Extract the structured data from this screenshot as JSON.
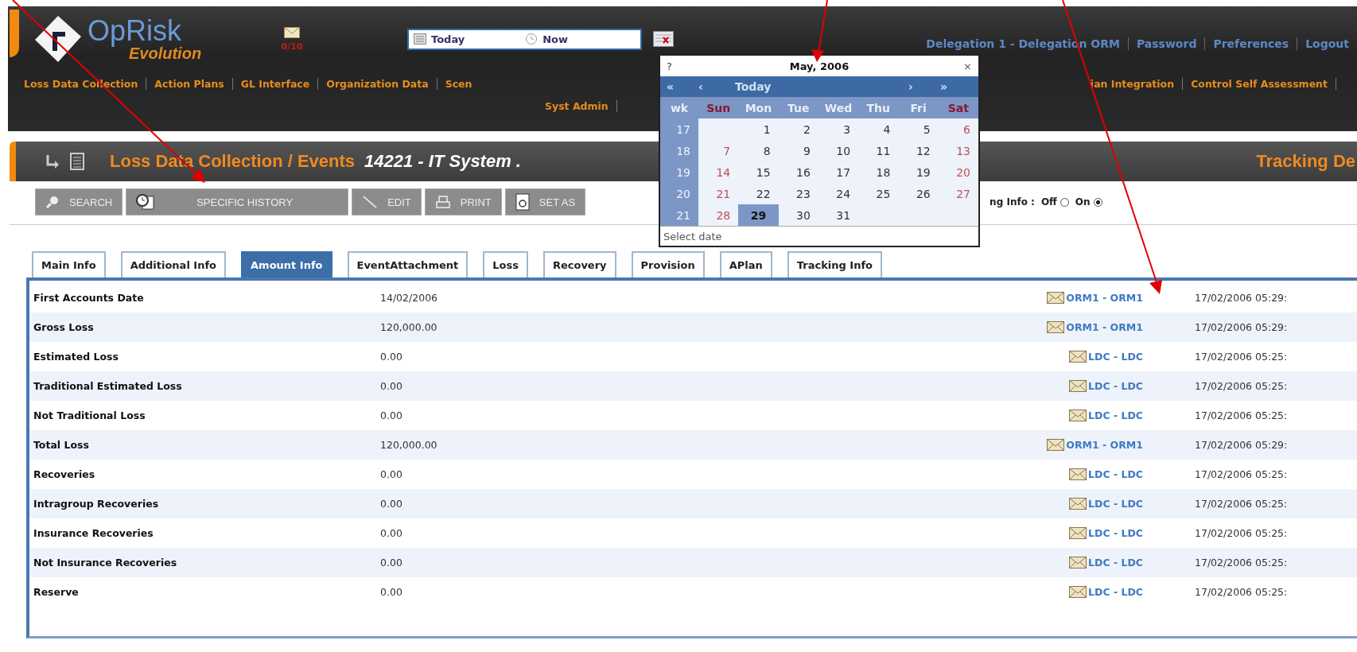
{
  "header": {
    "logo": {
      "name": "OpRisk",
      "tagline": "Evolution"
    },
    "messages": {
      "count": "0/10"
    },
    "date_field": {
      "today": "Today",
      "now": "Now"
    },
    "user_links": [
      "Delegation 1 - Delegation ORM",
      "Password",
      "Preferences",
      "Logout"
    ],
    "menu_left": [
      "Loss Data Collection",
      "Action Plans",
      "GL Interface",
      "Organization Data",
      "Scen"
    ],
    "menu_right": [
      "ian Integration",
      "Control Self Assessment"
    ],
    "menu_second": [
      "Syst Admin"
    ]
  },
  "calendar": {
    "help": "?",
    "title": "May, 2006",
    "close": "×",
    "nav": [
      "«",
      "‹",
      "Today",
      "›",
      "»"
    ],
    "week_label": "wk",
    "weekdays": [
      {
        "label": "Sun",
        "weekend": true
      },
      {
        "label": "Mon",
        "weekend": false
      },
      {
        "label": "Tue",
        "weekend": false
      },
      {
        "label": "Wed",
        "weekend": false
      },
      {
        "label": "Thu",
        "weekend": false
      },
      {
        "label": "Fri",
        "weekend": false
      },
      {
        "label": "Sat",
        "weekend": true
      }
    ],
    "weeks": [
      {
        "number": "17",
        "days": [
          {
            "d": "1",
            "selected": false
          },
          {
            "d": "2",
            "selected": false
          },
          {
            "d": "3",
            "selected": false
          },
          {
            "d": "4",
            "selected": false
          },
          {
            "d": "5",
            "selected": false
          },
          {
            "d": "6",
            "selected": false
          }
        ]
      },
      {
        "number": "18",
        "days": [
          {
            "d": "7",
            "selected": false
          },
          {
            "d": "8",
            "selected": false
          },
          {
            "d": "9",
            "selected": false
          },
          {
            "d": "10",
            "selected": false
          },
          {
            "d": "11",
            "selected": false
          },
          {
            "d": "12",
            "selected": false
          },
          {
            "d": "13",
            "selected": false
          }
        ]
      },
      {
        "number": "19",
        "days": [
          {
            "d": "14",
            "selected": false
          },
          {
            "d": "15",
            "selected": false
          },
          {
            "d": "16",
            "selected": false
          },
          {
            "d": "17",
            "selected": false
          },
          {
            "d": "18",
            "selected": false
          },
          {
            "d": "19",
            "selected": false
          },
          {
            "d": "20",
            "selected": false
          }
        ]
      },
      {
        "number": "20",
        "days": [
          {
            "d": "21",
            "selected": false
          },
          {
            "d": "22",
            "selected": false
          },
          {
            "d": "23",
            "selected": false
          },
          {
            "d": "24",
            "selected": false
          },
          {
            "d": "25",
            "selected": false
          },
          {
            "d": "26",
            "selected": false
          },
          {
            "d": "27",
            "selected": false
          }
        ]
      },
      {
        "number": "21",
        "days": [
          {
            "d": "28",
            "selected": false
          },
          {
            "d": "29",
            "selected": true
          },
          {
            "d": "30",
            "selected": false
          },
          {
            "d": "31",
            "selected": false
          }
        ]
      }
    ],
    "footer": "Select date"
  },
  "title_bar": {
    "module": "Loss Data Collection / Events",
    "record": "14221 - IT System .",
    "right": "Tracking De"
  },
  "toolbar": [
    {
      "label": "SEARCH",
      "kind": "search"
    },
    {
      "label": "SPECIFIC HISTORY",
      "kind": "history"
    },
    {
      "label": "EDIT",
      "kind": "edit"
    },
    {
      "label": "PRINT",
      "kind": "print"
    },
    {
      "label": "SET AS",
      "kind": "setting"
    }
  ],
  "tracking_info": {
    "label": "ng Info :",
    "options": [
      {
        "label": "Off",
        "selected": false
      },
      {
        "label": "On",
        "selected": true
      }
    ]
  },
  "tabs": [
    {
      "label": "Main Info",
      "selected": false
    },
    {
      "label": "Additional Info",
      "selected": false
    },
    {
      "label": "Amount Info",
      "selected": true
    },
    {
      "label": "EventAttachment",
      "selected": false
    },
    {
      "label": "Loss",
      "selected": false
    },
    {
      "label": "Recovery",
      "selected": false
    },
    {
      "label": "Provision",
      "selected": false
    },
    {
      "label": "APlan",
      "selected": false
    },
    {
      "label": "Tracking Info",
      "selected": false
    }
  ],
  "rows": [
    {
      "label": "First Accounts Date",
      "value": "14/02/2006",
      "user": "ORM1 - ORM1",
      "date": "17/02/2006 05:29:"
    },
    {
      "label": "Gross Loss",
      "value": "120,000.00",
      "user": "ORM1 - ORM1",
      "date": "17/02/2006 05:29:"
    },
    {
      "label": "Estimated Loss",
      "value": "0.00",
      "user": "LDC - LDC",
      "date": "17/02/2006 05:25:"
    },
    {
      "label": "Traditional Estimated Loss",
      "value": "0.00",
      "user": "LDC - LDC",
      "date": "17/02/2006 05:25:"
    },
    {
      "label": "Not Traditional Loss",
      "value": "0.00",
      "user": "LDC - LDC",
      "date": "17/02/2006 05:25:"
    },
    {
      "label": "Total Loss",
      "value": "120,000.00",
      "user": "ORM1 - ORM1",
      "date": "17/02/2006 05:29:"
    },
    {
      "label": "Recoveries",
      "value": "0.00",
      "user": "LDC - LDC",
      "date": "17/02/2006 05:25:"
    },
    {
      "label": "Intragroup Recoveries",
      "value": "0.00",
      "user": "LDC - LDC",
      "date": "17/02/2006 05:25:"
    },
    {
      "label": "Insurance Recoveries",
      "value": "0.00",
      "user": "LDC - LDC",
      "date": "17/02/2006 05:25:"
    },
    {
      "label": "Not Insurance Recoveries",
      "value": "0.00",
      "user": "LDC - LDC",
      "date": "17/02/2006 05:25:"
    },
    {
      "label": "Reserve",
      "value": "0.00",
      "user": "LDC - LDC",
      "date": "17/02/2006 05:25:"
    }
  ]
}
